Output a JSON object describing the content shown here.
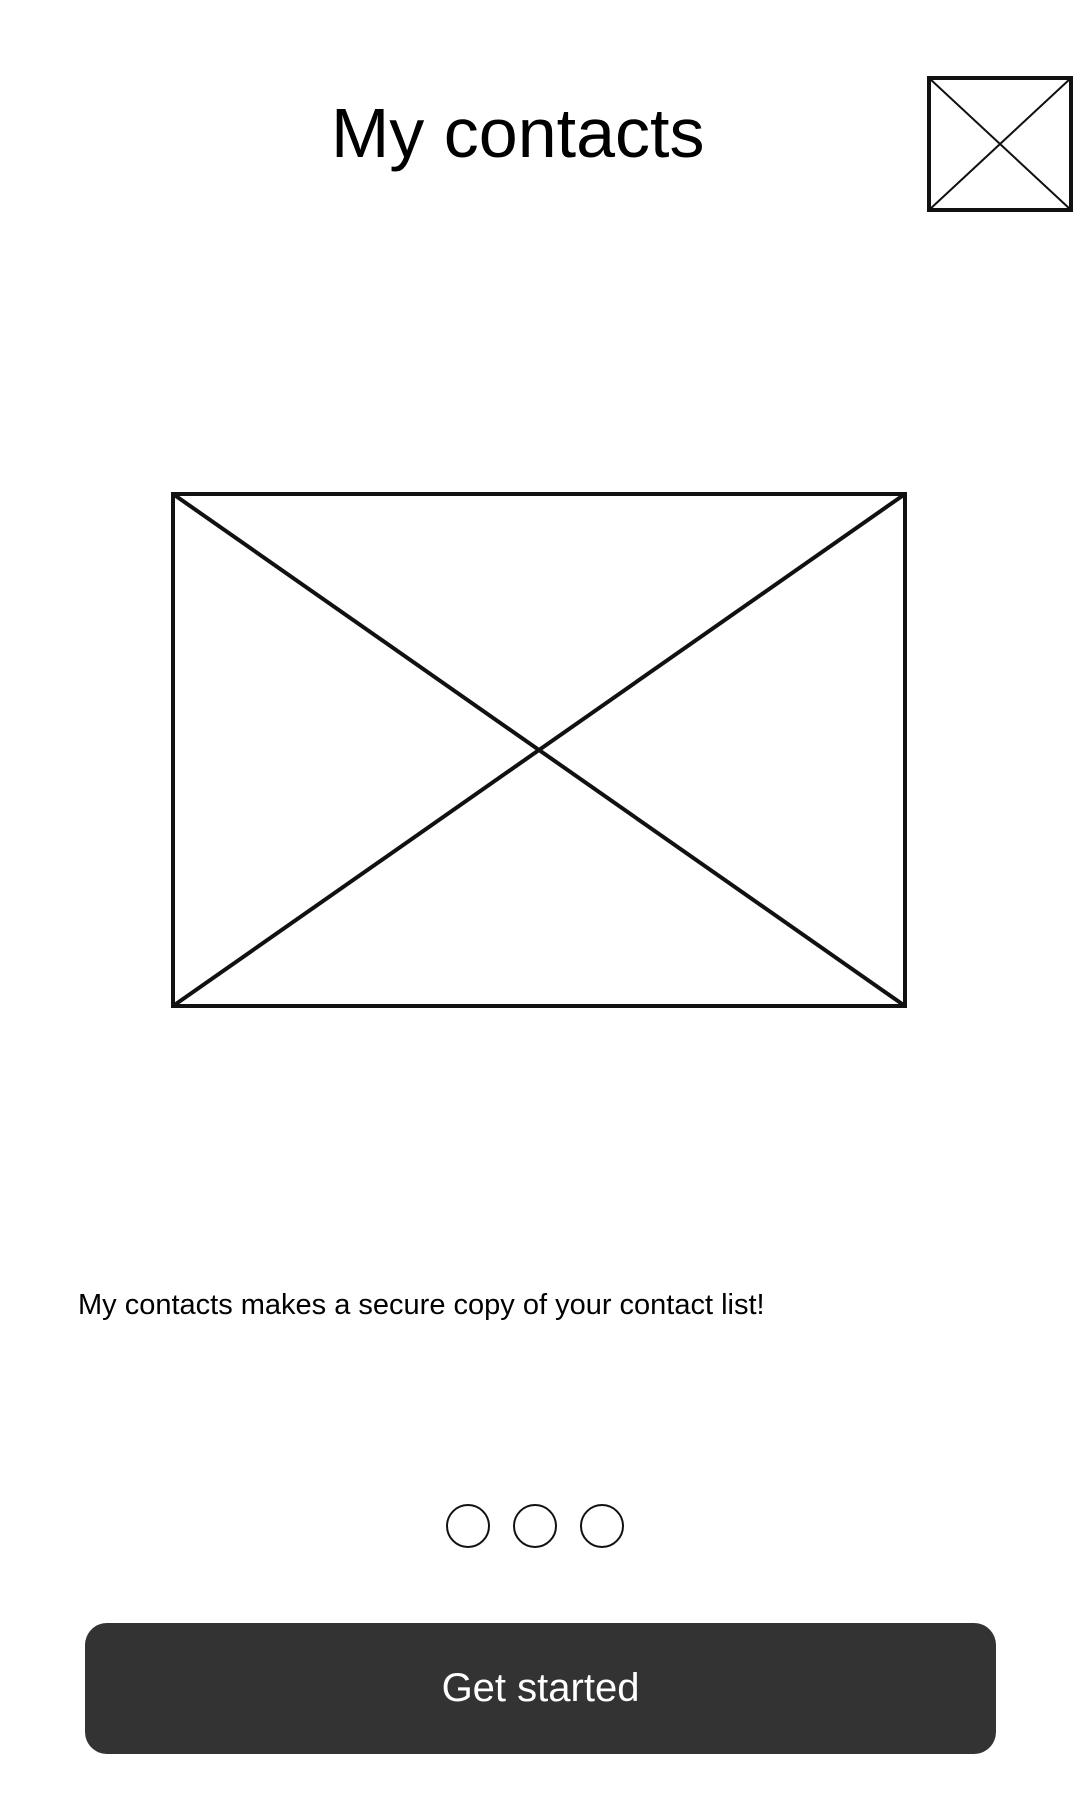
{
  "header": {
    "title": "My contacts",
    "corner_image_icon": "image-placeholder-icon"
  },
  "main": {
    "hero_image_icon": "image-placeholder-icon",
    "description": "My contacts makes a secure copy of your contact list!"
  },
  "pager": {
    "dots": 3,
    "active_index": null
  },
  "actions": {
    "get_started_label": "Get started"
  },
  "colors": {
    "background": "#ffffff",
    "text": "#000000",
    "button_background": "#333333",
    "button_text": "#ffffff"
  }
}
